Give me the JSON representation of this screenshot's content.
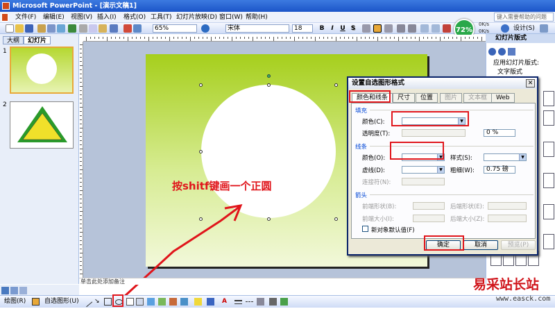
{
  "window": {
    "title": "Microsoft PowerPoint - [演示文稿1]"
  },
  "menus": [
    "文件(F)",
    "编辑(E)",
    "视图(V)",
    "插入(I)",
    "格式(O)",
    "工具(T)",
    "幻灯片放映(D)",
    "窗口(W)",
    "帮助(H)"
  ],
  "help_placeholder": "键入需要帮助的问题",
  "toolbar": {
    "zoom": "65%",
    "font": "宋体",
    "size": "18"
  },
  "format_buttons": [
    "B",
    "I",
    "U",
    "S"
  ],
  "network": {
    "percent": "72%",
    "up": "0K/s",
    "down": "0K/s",
    "design_label": "设计(S)"
  },
  "outline": {
    "tab_outline": "大纲",
    "tab_slides": "幻灯片",
    "slides": [
      "1",
      "2"
    ]
  },
  "notes_placeholder": "单击此处添加备注",
  "annotation": "按shitf键画一个正圆",
  "right_pane": {
    "title": "幻灯片版式",
    "apply": "应用幻灯片版式:",
    "text_layouts": "文字版式"
  },
  "drawbar": {
    "draw": "绘图(R)",
    "autoshapes": "自选图形(U)"
  },
  "dialog": {
    "title": "设置自选图形格式",
    "tabs": [
      "颜色和线条",
      "尺寸",
      "位置",
      "图片",
      "文本框",
      "Web"
    ],
    "fill_section": "填充",
    "fill_color": "颜色(C):",
    "transparency": "透明度(T):",
    "transparency_value": "0 %",
    "line_section": "线条",
    "line_color": "颜色(O):",
    "dash": "虚线(D):",
    "connector": "连接符(N):",
    "style": "样式(S):",
    "weight": "粗细(W):",
    "weight_value": "0.75 磅",
    "arrow_section": "箭头",
    "begin_style": "前端形状(B):",
    "begin_size": "前端大小(I):",
    "end_style": "后端形状(E):",
    "end_size": "后端大小(Z):",
    "default_check": "新对象默认值(F)",
    "ok": "确定",
    "cancel": "取消",
    "preview": "预览(P)"
  },
  "watermark": {
    "brand": "易采站长站",
    "url": "www.easck.com"
  },
  "colors": {
    "accent_red": "#e0151b",
    "slide_green": "#a6cf1c"
  }
}
